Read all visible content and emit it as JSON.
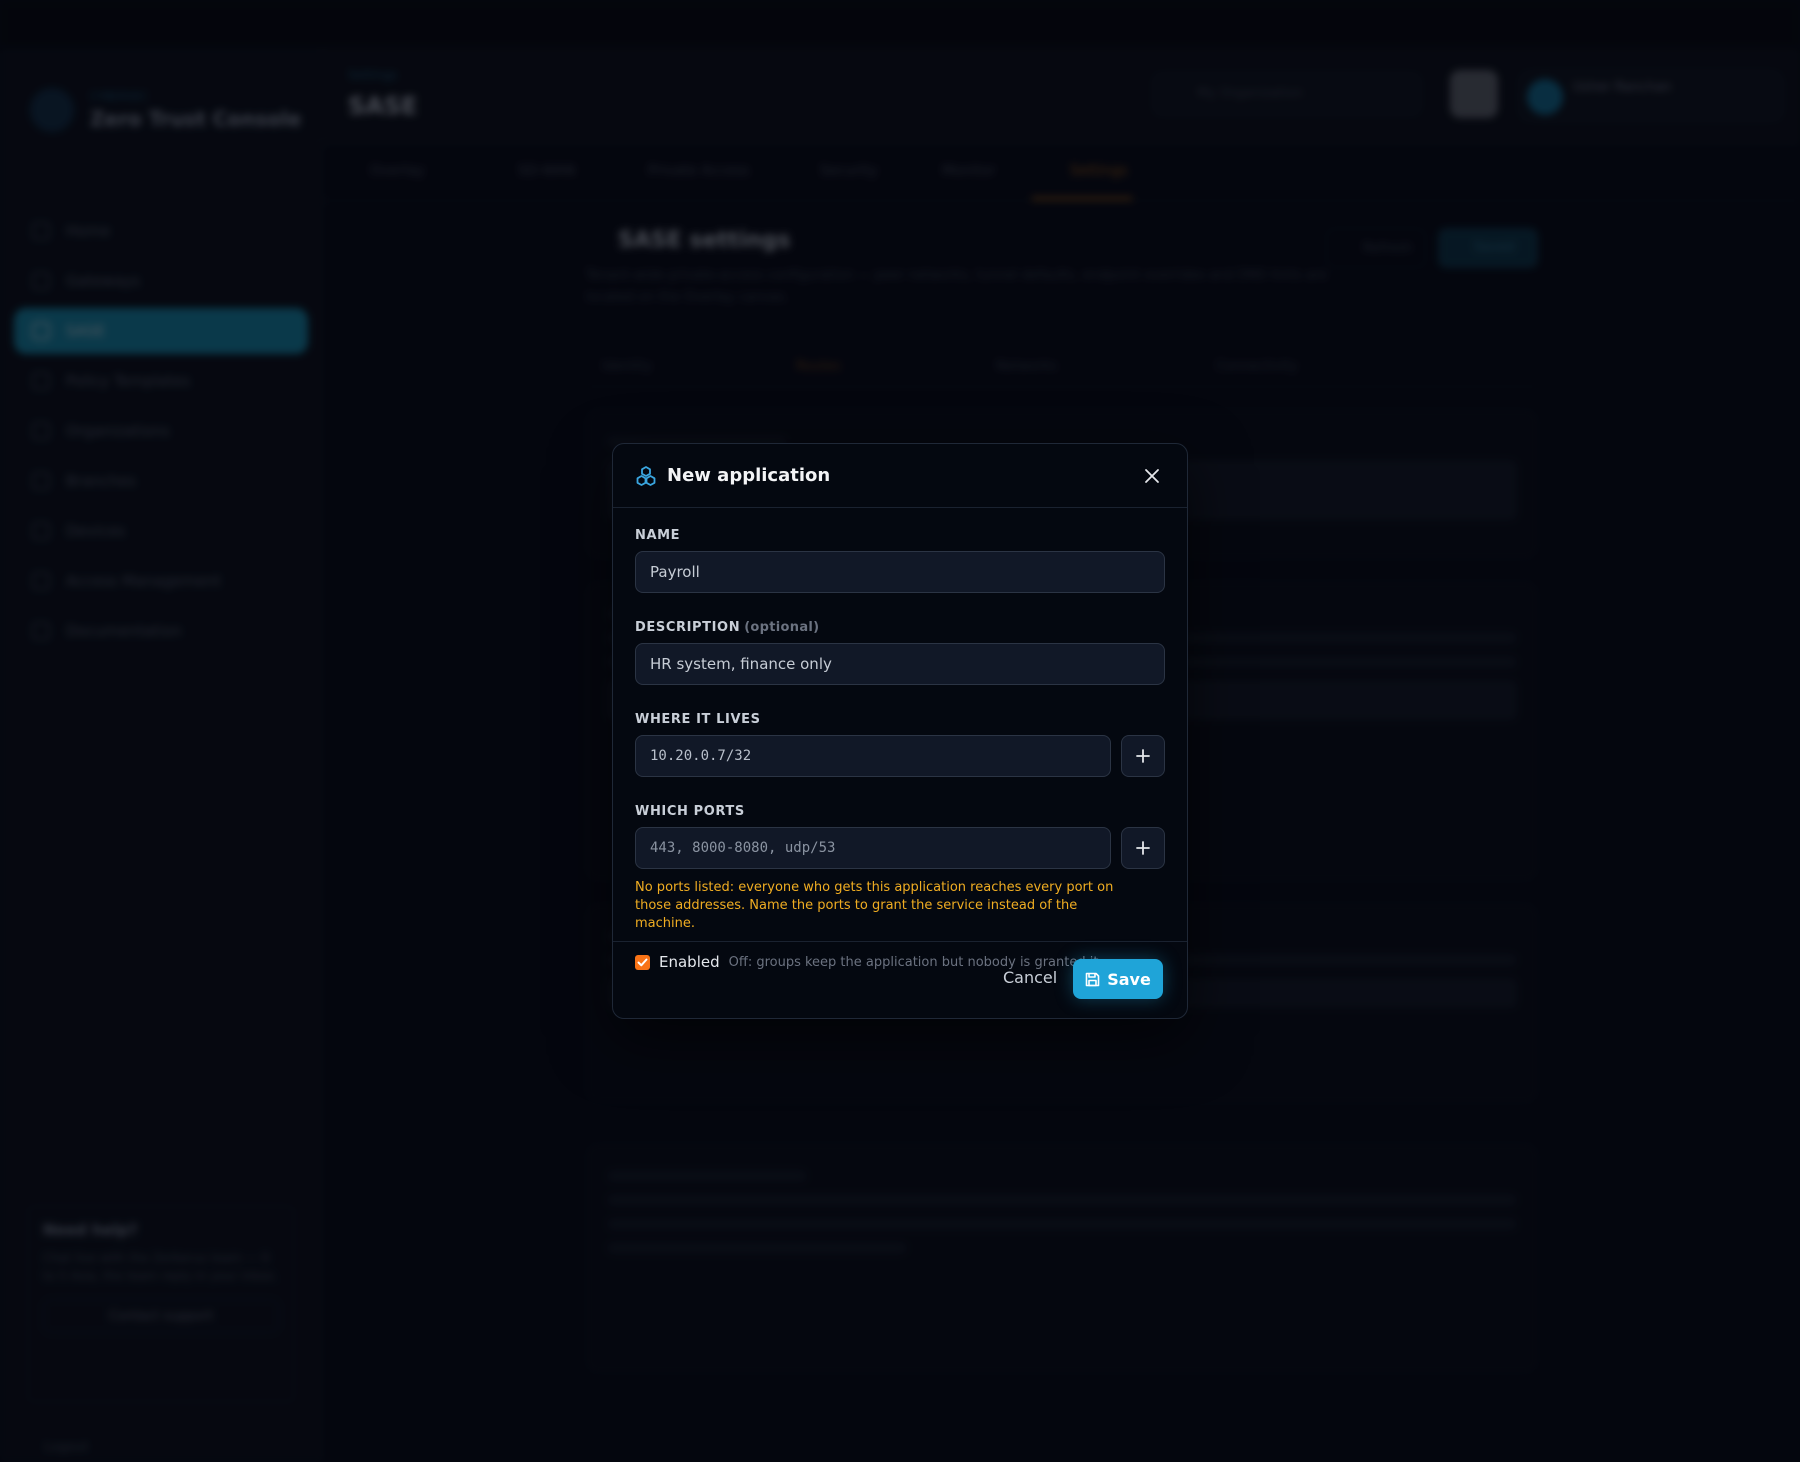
{
  "background": {
    "brand": {
      "kicker": "CYBERSEC",
      "name": "Zero Trust Console"
    },
    "nav": [
      {
        "label": "Home",
        "active": false
      },
      {
        "label": "Gateways",
        "active": false
      },
      {
        "label": "SASE",
        "active": true
      },
      {
        "label": "Policy Templates",
        "active": false
      },
      {
        "label": "Organizations",
        "active": false
      },
      {
        "label": "Branches",
        "active": false
      },
      {
        "label": "Devices",
        "active": false
      },
      {
        "label": "Access Management",
        "active": false
      },
      {
        "label": "Documentation",
        "active": false
      }
    ],
    "help": {
      "title": "Need help?",
      "text": "Chat live with the Zerberus team — 9 to 5 Asia, the team reply in your inbox.",
      "button": "Contact support"
    },
    "logout": "Logout",
    "breadcrumb": "Settings",
    "page_title": "SASE",
    "org_selector": "My Organization",
    "user_name": "Usher Ranchan",
    "tabs": [
      "Overlay",
      "SD-WAN",
      "Private Access",
      "Security",
      "Monitor",
      "Settings"
    ],
    "section_title": "SASE settings",
    "section_subtitle": "Tenant-wide private-access configuration — peer networks, tunnel defaults, endpoint overrides and DNS hints are located on the Overlay canvas.",
    "section_buttons": [
      "Refresh",
      "Saved"
    ],
    "subtabs": [
      "Identity",
      "Routes",
      "Networks",
      "Connectivity"
    ]
  },
  "modal": {
    "title": "New application",
    "name_label": "Name",
    "name_value": "Payroll",
    "description_label": "Description",
    "description_optional": "(optional)",
    "description_value": "HR system, finance only",
    "where_label": "Where it lives",
    "where_value": "10.20.0.7/32",
    "ports_label": "Which ports",
    "ports_value": "443, 8000-8080, udp/53",
    "ports_warning": "No ports listed: everyone who gets this application reaches every port on those addresses. Name the ports to grant the service instead of the machine.",
    "enabled_label": "Enabled",
    "enabled_hint": "Off: groups keep the application but nobody is granted it.",
    "enabled": true,
    "cancel_label": "Cancel",
    "save_label": "Save"
  },
  "colors": {
    "accent": "#1fa4d8",
    "warning": "#f0ad22",
    "checkbox": "#f97316",
    "active_tab": "#b5650f"
  },
  "icons": {
    "modal": "apps-cluster-icon",
    "close": "close-icon",
    "add": "plus-icon",
    "save": "floppy-disk-icon"
  }
}
